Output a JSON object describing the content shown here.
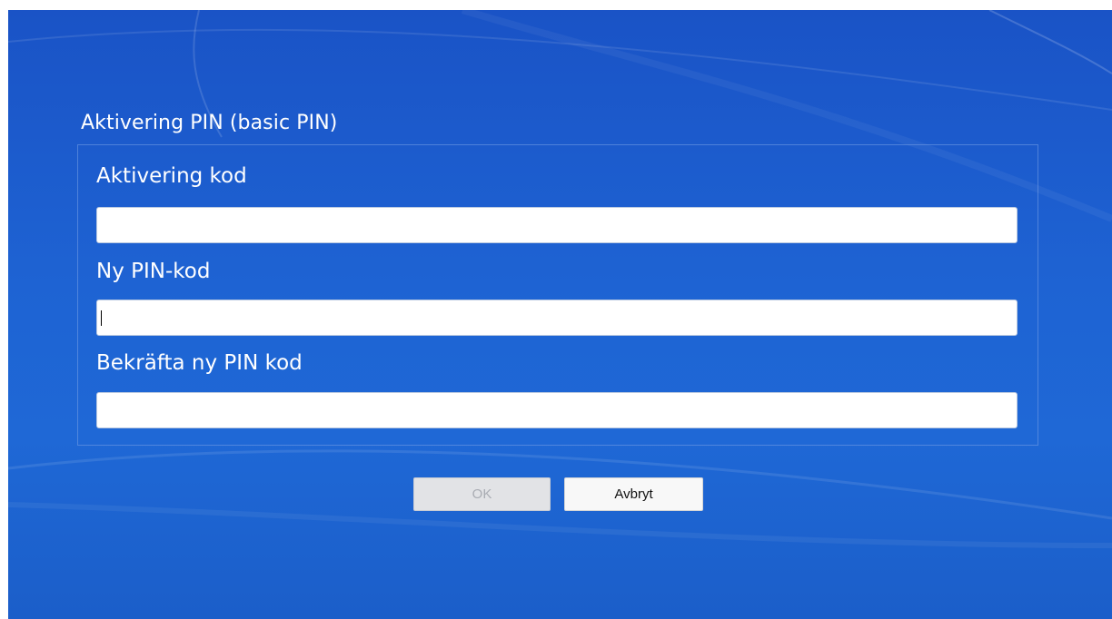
{
  "dialog": {
    "title": "Aktivering PIN (basic PIN)"
  },
  "form": {
    "activation_code": {
      "label": "Aktivering kod",
      "value": ""
    },
    "new_pin": {
      "label": "Ny PIN-kod",
      "value": ""
    },
    "confirm_pin": {
      "label": "Bekräfta ny PIN kod",
      "value": ""
    }
  },
  "buttons": {
    "ok_label": "OK",
    "ok_enabled": false,
    "cancel_label": "Avbryt"
  },
  "colors": {
    "background": "#1e63d3",
    "text": "#ffffff",
    "disabled_text": "#a9acb3"
  }
}
